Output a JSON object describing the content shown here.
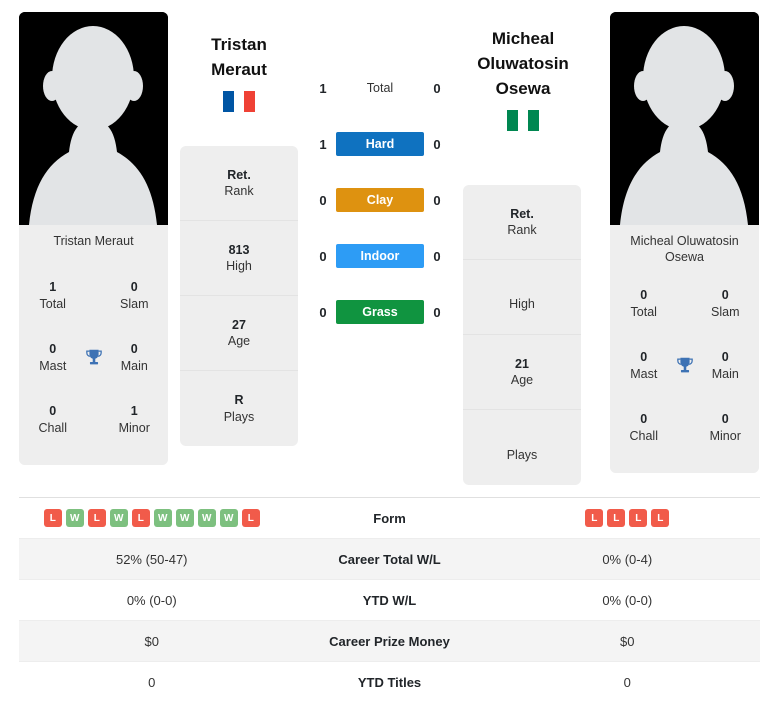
{
  "players": {
    "left": {
      "name_lines": [
        "Tristan",
        "Meraut"
      ],
      "card_name": "Tristan Meraut",
      "flag_name": "france-flag",
      "flag_colors": [
        "#0055A4",
        "#FFFFFF",
        "#EF4135"
      ],
      "info": [
        {
          "value": "Ret.",
          "label": "Rank"
        },
        {
          "value": "813",
          "label": "High"
        },
        {
          "value": "27",
          "label": "Age"
        },
        {
          "value": "R",
          "label": "Plays"
        }
      ],
      "achievements": [
        {
          "left_value": "1",
          "left_label": "Total",
          "right_value": "0",
          "right_label": "Slam"
        },
        {
          "left_value": "0",
          "left_label": "Mast",
          "right_value": "0",
          "right_label": "Main"
        },
        {
          "left_value": "0",
          "left_label": "Chall",
          "right_value": "1",
          "right_label": "Minor"
        }
      ]
    },
    "right": {
      "name_lines": [
        "Micheal",
        "Oluwatosin",
        "Osewa"
      ],
      "card_name_lines": [
        "Micheal Oluwatosin",
        "Osewa"
      ],
      "flag_name": "nigeria-flag",
      "flag_colors": [
        "#008751",
        "#FFFFFF",
        "#008751"
      ],
      "info": [
        {
          "value": "Ret.",
          "label": "Rank"
        },
        {
          "value": "",
          "label": "High"
        },
        {
          "value": "21",
          "label": "Age"
        },
        {
          "value": "",
          "label": "Plays"
        }
      ],
      "achievements": [
        {
          "left_value": "0",
          "left_label": "Total",
          "right_value": "0",
          "right_label": "Slam"
        },
        {
          "left_value": "0",
          "left_label": "Mast",
          "right_value": "0",
          "right_label": "Main"
        },
        {
          "left_value": "0",
          "left_label": "Chall",
          "right_value": "0",
          "right_label": "Minor"
        }
      ]
    }
  },
  "surfaces": [
    {
      "label": "Total",
      "left": "1",
      "right": "0",
      "color": "transparent",
      "plain": true
    },
    {
      "label": "Hard",
      "left": "1",
      "right": "0",
      "color": "#0f72c0",
      "plain": false
    },
    {
      "label": "Clay",
      "left": "0",
      "right": "0",
      "color": "#de9210",
      "plain": false
    },
    {
      "label": "Indoor",
      "left": "0",
      "right": "0",
      "color": "#2d9cf5",
      "plain": false
    },
    {
      "label": "Grass",
      "left": "0",
      "right": "0",
      "color": "#109440",
      "plain": false
    }
  ],
  "stats_rows": [
    {
      "label": "Form",
      "type": "form",
      "left_form": [
        "L",
        "W",
        "L",
        "W",
        "L",
        "W",
        "W",
        "W",
        "W",
        "L"
      ],
      "right_form": [
        "L",
        "L",
        "L",
        "L"
      ],
      "shaded": false
    },
    {
      "label": "Career Total W/L",
      "type": "text",
      "left": "52% (50-47)",
      "right": "0% (0-4)",
      "shaded": true
    },
    {
      "label": "YTD W/L",
      "type": "text",
      "left": "0% (0-0)",
      "right": "0% (0-0)",
      "shaded": false
    },
    {
      "label": "Career Prize Money",
      "type": "text",
      "left": "$0",
      "right": "$0",
      "shaded": true
    },
    {
      "label": "YTD Titles",
      "type": "text",
      "left": "0",
      "right": "0",
      "shaded": false
    }
  ],
  "icons": {
    "trophy": "trophy-icon",
    "avatar": "player-avatar-silhouette"
  },
  "colors": {
    "win_badge": "#7dc07f",
    "loss_badge": "#f15b4a",
    "trophy": "#3d72b4",
    "card_bg": "#eeeeee",
    "row_shaded": "#f4f4f4"
  }
}
